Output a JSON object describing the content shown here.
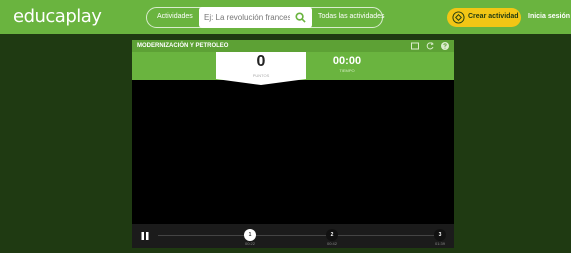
{
  "header": {
    "logo": "educaplay",
    "nav_activities": "Actividades",
    "search_placeholder": "Ej: La revolución francesa",
    "nav_all": "Todas las actividades",
    "create_label": "Crear actividad",
    "login_label": "Inicia sesión"
  },
  "player": {
    "title": "MODERNIZACIÓN Y PETROLEO",
    "score": "0",
    "score_label": "PUNTOS",
    "time": "00:00",
    "time_label": "TIEMPO",
    "markers": [
      {
        "number": "1",
        "time": "00:22"
      },
      {
        "number": "2",
        "time": "00:42"
      },
      {
        "number": "3",
        "time": "01:39"
      }
    ]
  },
  "colors": {
    "brand_green": "#6ab43f",
    "dark_green": "#1f3a12",
    "accent_yellow": "#f2c615"
  }
}
